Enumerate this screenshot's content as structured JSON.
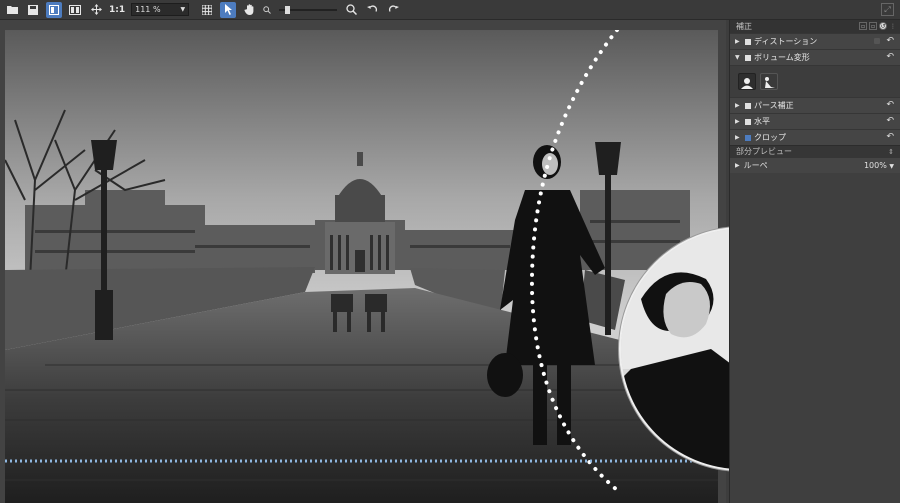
{
  "toolbar": {
    "actual_size_label": "1:1",
    "zoom_value": "111 %",
    "slider_level": 0.12,
    "icons": [
      "folder-icon",
      "save-icon",
      "compare-icon",
      "split-view-icon",
      "move-icon",
      "grid-icon",
      "pointer-icon",
      "hand-icon",
      "zoom-out-icon",
      "zoom-in-icon",
      "rotate-left-icon",
      "rotate-right-icon",
      "fullscreen-icon"
    ]
  },
  "panel": {
    "header": "補正",
    "items": [
      {
        "label": "ディストーション",
        "expanded": false,
        "checked": false
      },
      {
        "label": "ボリューム変形",
        "expanded": true,
        "checked": false
      },
      {
        "label": "パース補正",
        "expanded": false,
        "checked": false
      },
      {
        "label": "水平",
        "expanded": false,
        "checked": false
      },
      {
        "label": "クロップ",
        "expanded": false,
        "checked": true
      }
    ],
    "preview_section": "部分プレビュー",
    "loupe_label": "ルーペ",
    "loupe_value": "100%"
  },
  "colors": {
    "accent": "#4d7cbf",
    "guide_line": "#8fb7e0"
  }
}
